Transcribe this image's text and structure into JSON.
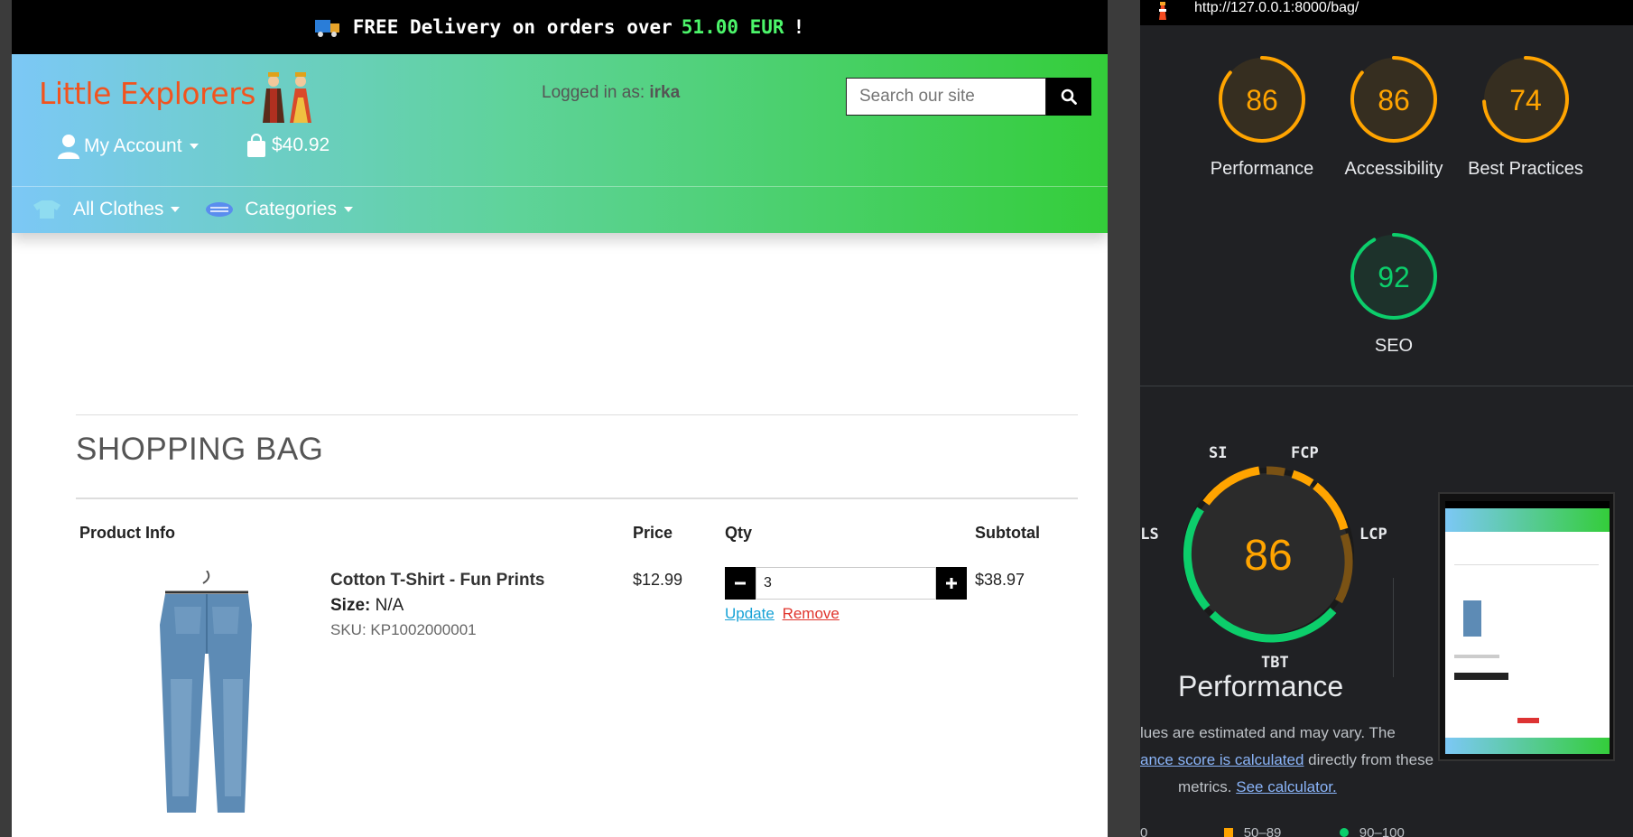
{
  "banner": {
    "prefix": "FREE Delivery on orders over",
    "amount": "51.00 EUR",
    "suffix": "!"
  },
  "header": {
    "logo": "Little Explorers",
    "login_prefix": "Logged in as:",
    "login_user": "irka",
    "search_placeholder": "Search our site",
    "account_label": "My Account",
    "bag_total": "$40.92",
    "nav": {
      "all_clothes": "All Clothes",
      "categories": "Categories"
    }
  },
  "bag": {
    "title": "SHOPPING BAG",
    "headers": {
      "product": "Product Info",
      "price": "Price",
      "qty": "Qty",
      "subtotal": "Subtotal"
    },
    "item": {
      "name": "Cotton T-Shirt - Fun Prints",
      "size_label": "Size:",
      "size_value": "N/A",
      "sku": "SKU: KP1002000001",
      "price": "$12.99",
      "qty": "3",
      "update": "Update",
      "remove": "Remove",
      "subtotal": "$38.97"
    }
  },
  "lighthouse": {
    "url": "http://127.0.0.1:8000/bag/",
    "scores": [
      {
        "name": "Performance",
        "score": 86,
        "status": "average"
      },
      {
        "name": "Accessibility",
        "score": 86,
        "status": "average"
      },
      {
        "name": "Best Practices",
        "score": 74,
        "status": "average"
      },
      {
        "name": "SEO",
        "score": 92,
        "status": "pass"
      }
    ],
    "colors": {
      "average": "#ffa400",
      "pass": "#0cce6b",
      "fail": "#ff4e42"
    },
    "big_score": "86",
    "metrics": {
      "si": "SI",
      "fcp": "FCP",
      "lcp": "LCP",
      "tbt": "TBT",
      "cls": "CLS"
    },
    "perf_title": "Performance",
    "desc1": "lues are estimated and may vary. The",
    "desc2_link": "ance score is calculated",
    "desc2_rest": " directly from these",
    "desc3_prefix": "metrics.",
    "desc3_link": "See calculator.",
    "legend": [
      "0",
      "50–89",
      "90–100"
    ]
  }
}
